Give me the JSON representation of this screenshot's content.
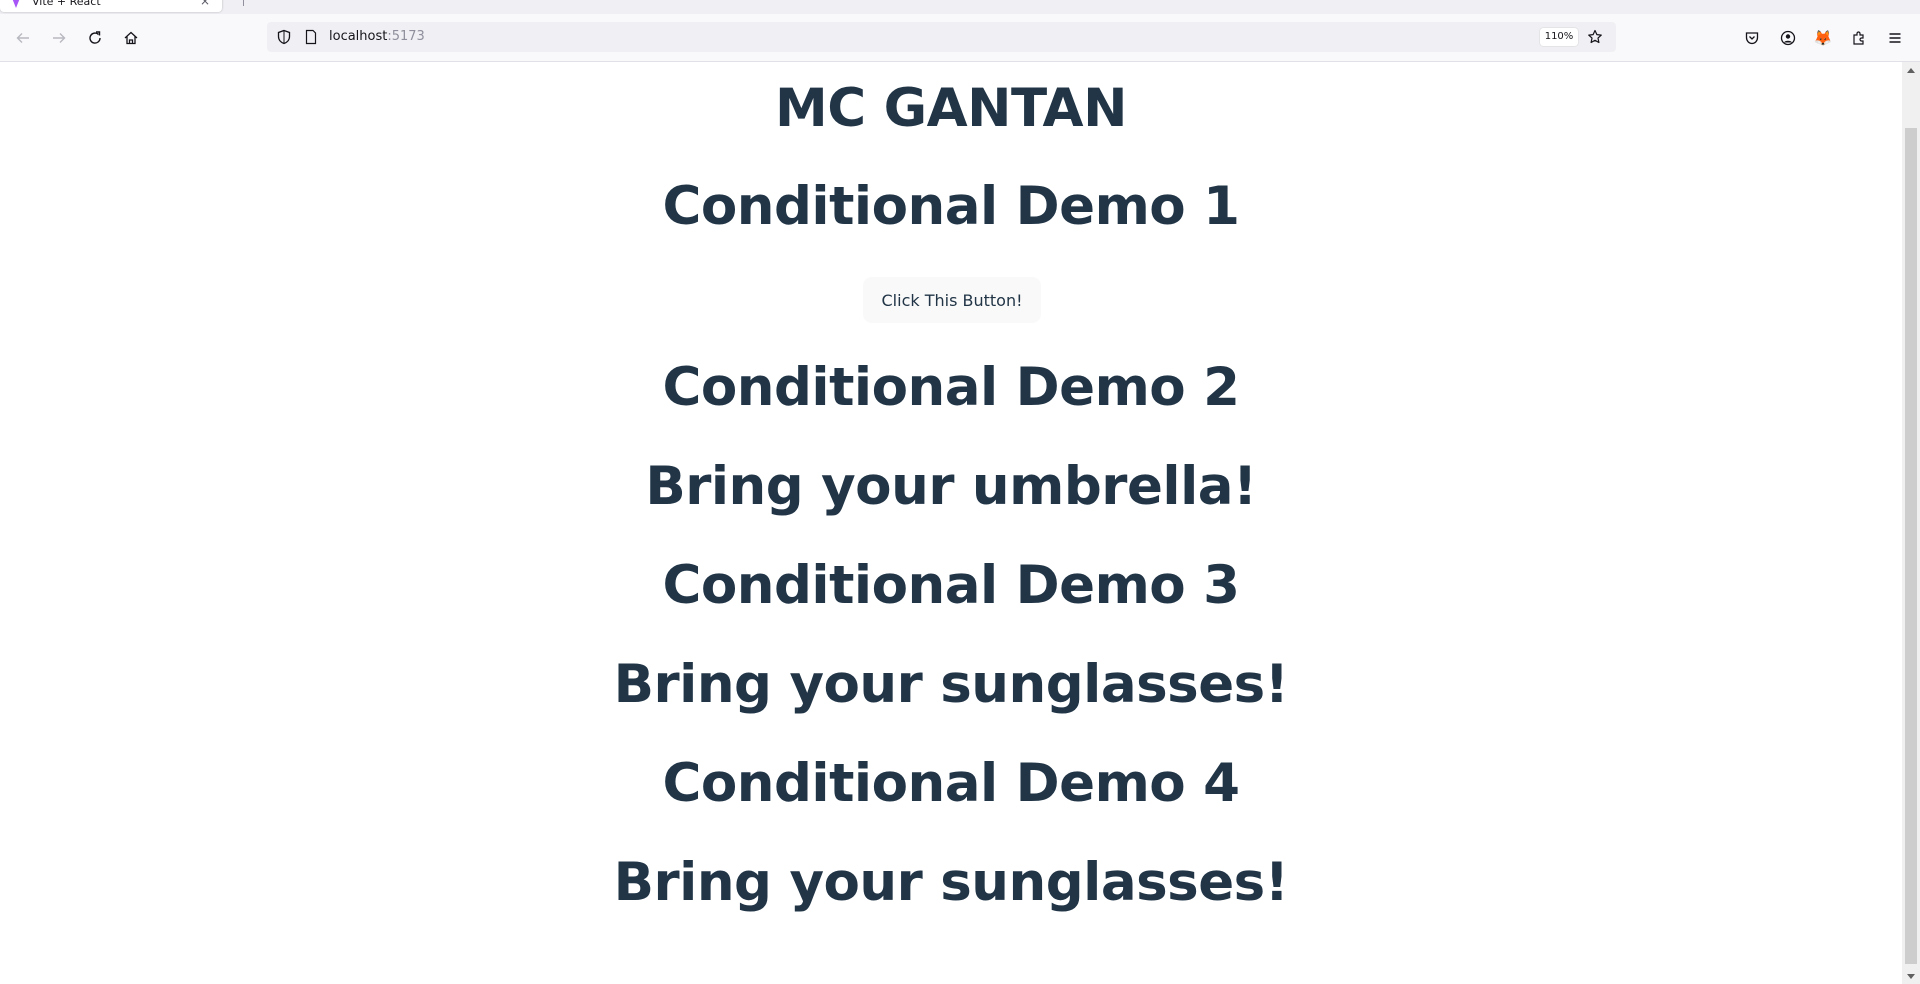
{
  "browser": {
    "tab_title": "Vite + React",
    "tab_close": "×",
    "url_host": "localhost",
    "url_port": ":5173",
    "zoom": "110%",
    "icons": {
      "back": "back-arrow-icon",
      "forward": "forward-arrow-icon",
      "reload": "reload-icon",
      "home": "home-icon",
      "shield": "tracking-protection-shield-icon",
      "page": "page-info-icon",
      "bookmark": "star-icon",
      "pocket": "pocket-icon",
      "account": "account-icon",
      "metamask": "fox-extension-icon",
      "extensions": "extensions-puzzle-icon",
      "menu": "hamburger-menu-icon"
    },
    "fox_glyph": "🦊"
  },
  "page": {
    "title": "MC GANTAN",
    "demo1_heading": "Conditional Demo 1",
    "button_label": "Click This Button!",
    "demo2_heading": "Conditional Demo 2",
    "demo2_message": "Bring your umbrella!",
    "demo3_heading": "Conditional Demo 3",
    "demo3_message": "Bring your sunglasses!",
    "demo4_heading": "Conditional Demo 4",
    "demo4_message": "Bring your sunglasses!"
  },
  "colors": {
    "text": "#213547",
    "button_bg": "#f9f9f9",
    "chrome_bg": "#f9f9fb",
    "urlbar_bg": "#f0f0f4"
  }
}
